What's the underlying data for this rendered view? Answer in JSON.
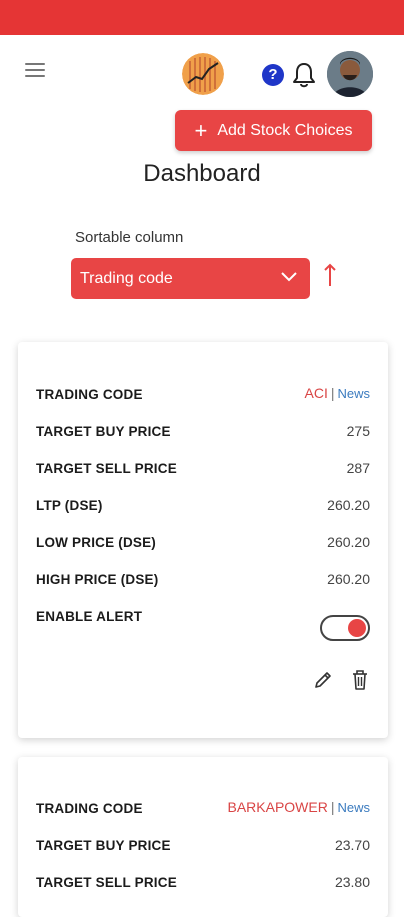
{
  "header": {
    "brand_color": "#e53535",
    "menu_icon": "hamburger-icon",
    "logo_icon": "stock-chart-logo",
    "help_icon_text": "?",
    "bell_icon": "bell-icon",
    "avatar": "user-avatar"
  },
  "actions": {
    "add_label": "Add Stock Choices"
  },
  "page": {
    "title": "Dashboard"
  },
  "sort": {
    "label": "Sortable column",
    "selected": "Trading code",
    "direction_icon": "arrow-up-icon"
  },
  "cards": [
    {
      "rows": [
        {
          "label": "TRADING CODE",
          "code": "ACI",
          "sep": "|",
          "news": "News"
        },
        {
          "label": "TARGET BUY PRICE",
          "value": "275"
        },
        {
          "label": "TARGET SELL PRICE",
          "value": "287"
        },
        {
          "label": "LTP (DSE)",
          "value": "260.20"
        },
        {
          "label": "LOW PRICE (DSE)",
          "value": "260.20"
        },
        {
          "label": "HIGH PRICE (DSE)",
          "value": "260.20"
        },
        {
          "label": "ENABLE ALERT",
          "toggle_on": true
        }
      ]
    },
    {
      "rows": [
        {
          "label": "TRADING CODE",
          "code": "BARKAPOWER",
          "sep": "|",
          "news": "News"
        },
        {
          "label": "TARGET BUY PRICE",
          "value": "23.70"
        },
        {
          "label": "TARGET SELL PRICE",
          "value": "23.80"
        }
      ]
    }
  ]
}
